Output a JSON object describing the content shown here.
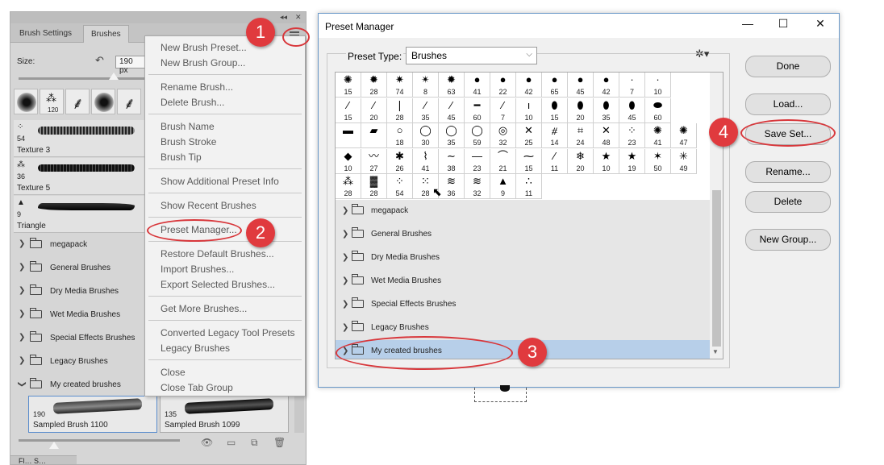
{
  "brushes_panel": {
    "tabs": [
      "Brush Settings",
      "Brushes"
    ],
    "panel_controls": [
      "◂◂",
      "✕"
    ],
    "size_label": "Size:",
    "size_value": "190 px",
    "tip_strip": [
      "120"
    ],
    "brush_list": [
      {
        "mini": "⁘",
        "num": "54",
        "name": "Texture 3"
      },
      {
        "mini": "⁂",
        "num": "36",
        "name": "Texture 5"
      },
      {
        "mini": "▲",
        "num": "9",
        "name": "Triangle"
      }
    ],
    "folders": [
      "megapack",
      "General Brushes",
      "Dry Media Brushes",
      "Wet Media Brushes",
      "Special Effects Brushes",
      "Legacy Brushes",
      "My created brushes"
    ],
    "samples": [
      {
        "num": "190",
        "name": "Sampled Brush 1100"
      },
      {
        "num": "135",
        "name": "Sampled Brush 1099"
      }
    ],
    "bottom_tab_label": "Fl… S…"
  },
  "flyout_menu": {
    "items": [
      "New Brush Preset...",
      "New Brush Group...",
      "Rename Brush...",
      "Delete Brush...",
      "Brush Name",
      "Brush Stroke",
      "Brush Tip",
      "Show Additional Preset Info",
      "Show Recent Brushes",
      "Preset Manager...",
      "Restore Default Brushes...",
      "Import Brushes...",
      "Export Selected Brushes...",
      "Get More Brushes...",
      "Converted Legacy Tool Presets",
      "Legacy Brushes",
      "Close",
      "Close Tab Group"
    ]
  },
  "preset_manager": {
    "title": "Preset Manager",
    "window_controls": [
      "—",
      "☐",
      "✕"
    ],
    "preset_type_label": "Preset Type:",
    "preset_type_value": "Brushes",
    "grid": {
      "rows": [
        [
          {
            "g": "✺",
            "n": "15"
          },
          {
            "g": "✹",
            "n": "28"
          },
          {
            "g": "✷",
            "n": "74"
          },
          {
            "g": "✴",
            "n": "8"
          },
          {
            "g": "✹",
            "n": "63"
          },
          {
            "g": "●",
            "n": "41"
          },
          {
            "g": "●",
            "n": "22"
          },
          {
            "g": "●",
            "n": "42"
          },
          {
            "g": "●",
            "n": "65"
          },
          {
            "g": "●",
            "n": "45"
          },
          {
            "g": "●",
            "n": "42"
          },
          {
            "g": "·",
            "n": "7"
          },
          {
            "g": "·",
            "n": "10"
          }
        ],
        [
          {
            "g": "⁄",
            "n": "15"
          },
          {
            "g": "⁄",
            "n": "20"
          },
          {
            "g": "❘",
            "n": "28"
          },
          {
            "g": "⁄",
            "n": "35"
          },
          {
            "g": "⁄",
            "n": "45"
          },
          {
            "g": "━",
            "n": "60"
          },
          {
            "g": "⁄",
            "n": "7"
          },
          {
            "g": "ı",
            "n": "10"
          },
          {
            "g": "⬮",
            "n": "15"
          },
          {
            "g": "⬮",
            "n": "20"
          },
          {
            "g": "⬮",
            "n": "35"
          },
          {
            "g": "⬮",
            "n": "45"
          },
          {
            "g": "⬬",
            "n": "60"
          }
        ],
        [
          {
            "g": "▬",
            "n": ""
          },
          {
            "g": "▰",
            "n": ""
          },
          {
            "g": "○",
            "n": "18"
          },
          {
            "g": "◯",
            "n": "30"
          },
          {
            "g": "◯",
            "n": "35"
          },
          {
            "g": "◯",
            "n": "59"
          },
          {
            "g": "◎",
            "n": "32"
          },
          {
            "g": "✕",
            "n": "25"
          },
          {
            "g": "⧣",
            "n": "14"
          },
          {
            "g": "⌗",
            "n": "24"
          },
          {
            "g": "✕",
            "n": "48"
          },
          {
            "g": "⁘",
            "n": "23"
          },
          {
            "g": "✺",
            "n": "41"
          },
          {
            "g": "✺",
            "n": "47"
          }
        ],
        [
          {
            "g": "◆",
            "n": "10"
          },
          {
            "g": "〰",
            "n": "27"
          },
          {
            "g": "✱",
            "n": "26"
          },
          {
            "g": "⌇",
            "n": "41"
          },
          {
            "g": "∼",
            "n": "38"
          },
          {
            "g": "—",
            "n": "23"
          },
          {
            "g": "⌒",
            "n": "21"
          },
          {
            "g": "⁓",
            "n": "15"
          },
          {
            "g": "⁄",
            "n": "11"
          },
          {
            "g": "❄",
            "n": "20"
          },
          {
            "g": "★",
            "n": "10"
          },
          {
            "g": "★",
            "n": "19"
          },
          {
            "g": "✶",
            "n": "50"
          },
          {
            "g": "✳",
            "n": "49"
          }
        ],
        [
          {
            "g": "⁂",
            "n": "28"
          },
          {
            "g": "▓",
            "n": "28"
          },
          {
            "g": "⁘",
            "n": "54"
          },
          {
            "g": "⁙",
            "n": "28"
          },
          {
            "g": "≋",
            "n": "36"
          },
          {
            "g": "≋",
            "n": "32"
          },
          {
            "g": "▲",
            "n": "9"
          },
          {
            "g": "∴",
            "n": "11"
          }
        ]
      ]
    },
    "folders": [
      "megapack",
      "General Brushes",
      "Dry Media Brushes",
      "Wet Media Brushes",
      "Special Effects Brushes",
      "Legacy Brushes",
      "My created brushes"
    ],
    "buttons": [
      "Done",
      "Load...",
      "Save Set...",
      "Rename...",
      "Delete",
      "New Group..."
    ]
  },
  "annotations": [
    "1",
    "2",
    "3",
    "4"
  ],
  "colors": {
    "annotation": "#e03a3e",
    "selection": "#b7cfe9",
    "panel_bg": "#d6d6d6",
    "dialog_border": "#6a98c8"
  }
}
